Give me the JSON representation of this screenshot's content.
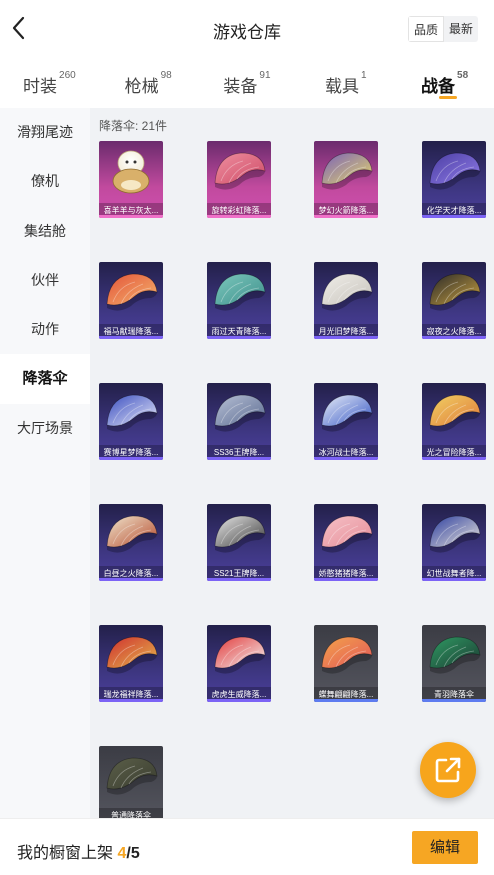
{
  "header": {
    "title": "游戏仓库",
    "sort": [
      "品质",
      "最新"
    ],
    "sort_active": 0
  },
  "tabs": [
    {
      "label": "时装",
      "count": "260"
    },
    {
      "label": "枪械",
      "count": "98"
    },
    {
      "label": "装备",
      "count": "91"
    },
    {
      "label": "载具",
      "count": "1"
    },
    {
      "label": "战备",
      "count": "58"
    }
  ],
  "active_tab": 4,
  "sidebar": [
    "滑翔尾迹",
    "僚机",
    "集结舱",
    "伙伴",
    "动作",
    "降落伞",
    "大厅场景"
  ],
  "active_side": 5,
  "content": {
    "count_text": "降落伞: 21件",
    "items": [
      {
        "label": "喜羊羊与灰太...",
        "rarity": "pink",
        "icon": "chibi-parachute-icon",
        "colors": [
          "#f3ecd8",
          "#d9b06a"
        ]
      },
      {
        "label": "旋转彩虹降落...",
        "rarity": "pink",
        "icon": "parachute-icon",
        "colors": [
          "#ee8fa0",
          "#cf4b66"
        ]
      },
      {
        "label": "梦幻火箭降落...",
        "rarity": "pink",
        "icon": "parachute-icon",
        "colors": [
          "#7b62b8",
          "#e3d56a"
        ]
      },
      {
        "label": "化学天才降落...",
        "rarity": "purple",
        "icon": "parachute-icon",
        "colors": [
          "#4c3fa3",
          "#8f7be8"
        ]
      },
      {
        "label": "福马献瑞降落...",
        "rarity": "purple",
        "icon": "parachute-icon",
        "colors": [
          "#e4553a",
          "#f3b36d"
        ]
      },
      {
        "label": "雨过天青降落...",
        "rarity": "purple",
        "icon": "parachute-icon",
        "colors": [
          "#7cc8bd",
          "#3e8f8b"
        ]
      },
      {
        "label": "月光旧梦降落...",
        "rarity": "purple",
        "icon": "parachute-icon",
        "colors": [
          "#f0eee9",
          "#c6c2bb"
        ]
      },
      {
        "label": "寂夜之火降落...",
        "rarity": "purple",
        "icon": "parachute-icon",
        "colors": [
          "#2a2a2a",
          "#c9a140"
        ]
      },
      {
        "label": "赛博星梦降落...",
        "rarity": "purple",
        "icon": "parachute-icon",
        "colors": [
          "#3a4ec0",
          "#e6e8f8"
        ]
      },
      {
        "label": "SS36王牌降...",
        "rarity": "purple",
        "icon": "parachute-icon",
        "colors": [
          "#b8c1d6",
          "#5a6a90"
        ]
      },
      {
        "label": "冰河战士降落...",
        "rarity": "purple",
        "icon": "parachute-icon",
        "colors": [
          "#e9eef8",
          "#3556c4"
        ]
      },
      {
        "label": "光之冒险降落...",
        "rarity": "purple",
        "icon": "parachute-icon",
        "colors": [
          "#f1d064",
          "#e07a3a"
        ]
      },
      {
        "label": "白昼之火降落...",
        "rarity": "purple",
        "icon": "parachute-icon",
        "colors": [
          "#f0e6cf",
          "#b54a2c"
        ]
      },
      {
        "label": "SS21王牌降...",
        "rarity": "purple",
        "icon": "parachute-icon",
        "colors": [
          "#e9e9e9",
          "#3b3b3b"
        ]
      },
      {
        "label": "娇憨猪猪降落...",
        "rarity": "purple",
        "icon": "parachute-icon",
        "colors": [
          "#f6c1c7",
          "#e58d98"
        ]
      },
      {
        "label": "幻世战舞者降...",
        "rarity": "purple",
        "icon": "parachute-icon",
        "colors": [
          "#2d3fa0",
          "#e9e4da"
        ]
      },
      {
        "label": "瑞龙福祥降落...",
        "rarity": "purple",
        "icon": "parachute-icon",
        "colors": [
          "#cf2f2f",
          "#e4b84c"
        ]
      },
      {
        "label": "虎虎生威降落...",
        "rarity": "purple",
        "icon": "parachute-icon",
        "colors": [
          "#e33b3b",
          "#f2f2f2"
        ]
      },
      {
        "label": "蝶舞翩翩降落...",
        "rarity": "gray",
        "icon": "parachute-icon",
        "colors": [
          "#f3a24a",
          "#e3575a"
        ]
      },
      {
        "label": "青羽降落伞",
        "rarity": "gray",
        "icon": "parachute-icon",
        "colors": [
          "#2f9a63",
          "#1c3c33"
        ]
      },
      {
        "label": "普通降落伞",
        "rarity": "gray",
        "icon": "parachute-icon",
        "colors": [
          "#5b5f49",
          "#3a3d30"
        ]
      }
    ]
  },
  "bottom": {
    "shelf_label": "我的橱窗上架",
    "shelf_current": "4",
    "shelf_sep": "/",
    "shelf_total": "5",
    "edit_label": "编辑"
  },
  "accent": "#f6a623"
}
